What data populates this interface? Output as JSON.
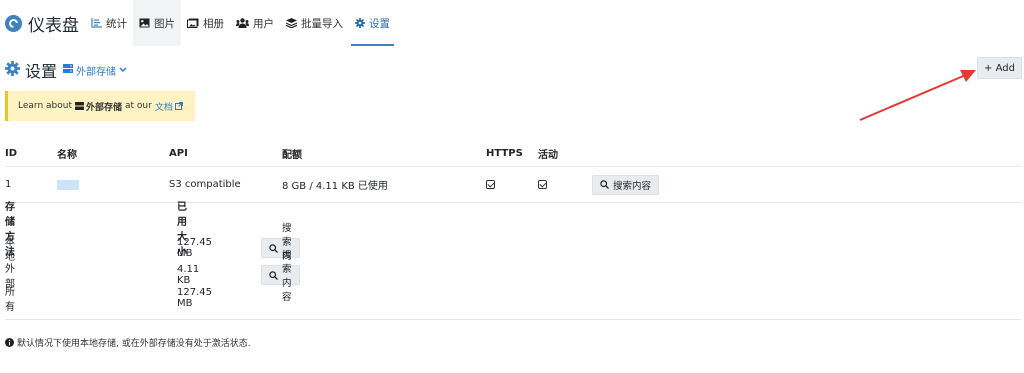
{
  "brand": {
    "title": "仪表盘"
  },
  "nav": {
    "items": [
      {
        "label": "统计",
        "icon": "chart-bar-icon"
      },
      {
        "label": "图片",
        "icon": "image-icon"
      },
      {
        "label": "相册",
        "icon": "album-icon"
      },
      {
        "label": "用户",
        "icon": "users-icon"
      },
      {
        "label": "批量导入",
        "icon": "layers-icon"
      },
      {
        "label": "设置",
        "icon": "gear-icon"
      }
    ],
    "active": "设置"
  },
  "section": {
    "title": "设置",
    "subtitle": "外部存储"
  },
  "add_button": {
    "label": "+ Add"
  },
  "alert": {
    "prefix": "Learn about",
    "strong": "外部存储",
    "middle": "at our",
    "link": "文档"
  },
  "table": {
    "headers": [
      "ID",
      "名称",
      "API",
      "配额",
      "HTTPS",
      "活动"
    ],
    "rows": [
      {
        "id": "1",
        "api": "S3 compatible",
        "quota": "8 GB / 4.11 KB 已使用",
        "https": true,
        "active": true,
        "button": "搜索内容"
      }
    ]
  },
  "storage": {
    "headers": [
      "存储方法",
      "已用大小"
    ],
    "rows": [
      {
        "method": "本地",
        "size": "127.45 MB",
        "button": "搜索内容"
      },
      {
        "method": "外部",
        "size": "4.11 KB",
        "button": "搜索内容"
      },
      {
        "method": "所有",
        "size": "127.45 MB"
      }
    ]
  },
  "footnote": "默认情况下使用本地存储, 或在外部存储没有处于激活状态.",
  "colors": {
    "accent": "#3d83c4",
    "link": "#2b7bd1",
    "alert_bg": "#fff3c4",
    "alert_border": "#f0c419",
    "annotation_arrow": "#e53935"
  }
}
